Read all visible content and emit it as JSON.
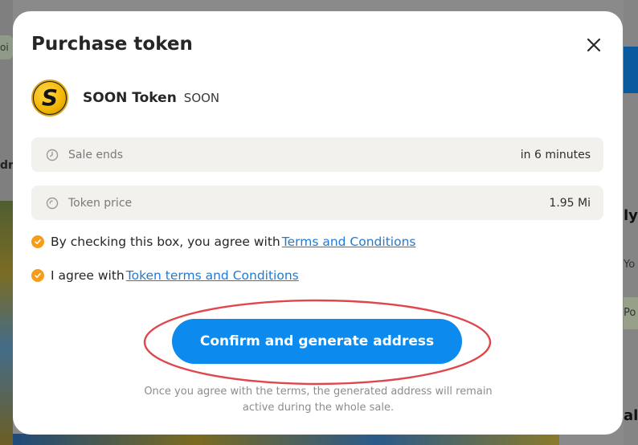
{
  "background": {
    "left_text": "dr",
    "left_pill_text": "oi",
    "right_heading_1": "ly",
    "right_small_1": "Yo",
    "right_small_2": "Po",
    "right_heading_2": "al"
  },
  "modal": {
    "title": "Purchase token",
    "close_icon": "close-icon",
    "token": {
      "logo_letter": "S",
      "name": "SOON Token",
      "symbol": "SOON"
    },
    "sale": {
      "icon": "clock-icon",
      "label": "Sale ends",
      "value": "in 6 minutes"
    },
    "price": {
      "icon": "coin-icon",
      "label": "Token price",
      "value": "1.95 Mi"
    },
    "terms": {
      "checked": true,
      "text": "By checking this box, you agree with",
      "link": "Terms and Conditions"
    },
    "token_terms": {
      "checked": true,
      "text": "I agree with",
      "link": "Token terms and Conditions"
    },
    "confirm_label": "Confirm and generate address",
    "footnote": "Once you agree with the terms, the generated address will remain active during the whole sale."
  },
  "colors": {
    "accent": "#0d8aee",
    "checkbox": "#f59d1a",
    "link": "#1f7ad8",
    "highlight": "#e0474c"
  }
}
